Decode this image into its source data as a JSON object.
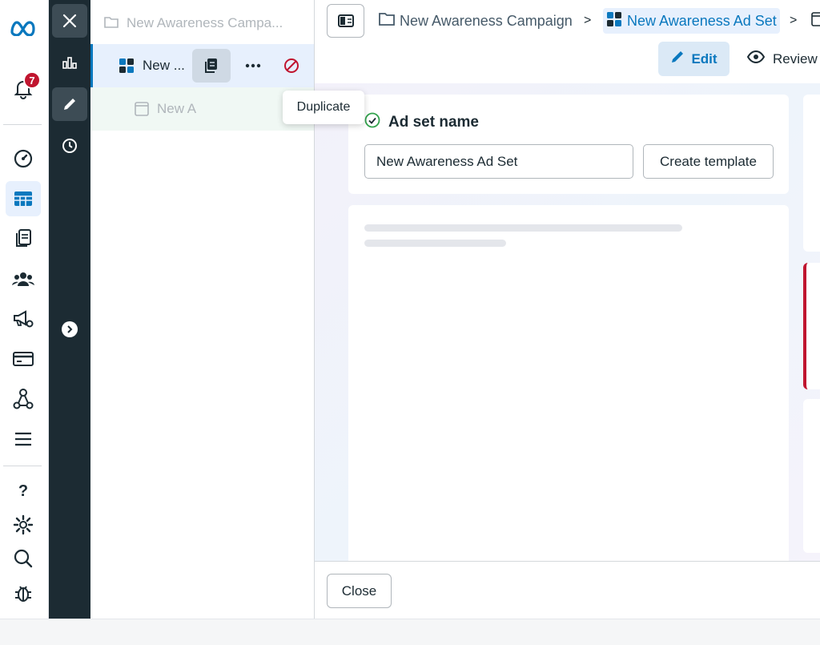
{
  "rail": {
    "notification_count": "7",
    "icons": [
      "meta-logo-icon",
      "bell-icon",
      "gauge-icon",
      "table-icon",
      "pages-icon",
      "people-icon",
      "megaphone-gear-icon",
      "card-icon",
      "network-icon",
      "menu-icon",
      "help-icon",
      "gear-icon",
      "search-icon",
      "bug-icon"
    ]
  },
  "strip": {
    "icons": [
      "close-icon",
      "bar-chart-icon",
      "pencil-icon",
      "clock-icon",
      "chevron-right-circle-icon"
    ]
  },
  "tree": {
    "campaign_label": "New Awareness Campa...",
    "adset_label": "New ...",
    "ad_label": "New A",
    "tooltip": "Duplicate"
  },
  "breadcrumb": {
    "campaign": "New Awareness Campaign",
    "adset": "New Awareness Ad Set",
    "separator": ">"
  },
  "actions": {
    "edit": "Edit",
    "review": "Review"
  },
  "adset_card": {
    "title": "Ad set name",
    "name_value": "New Awareness Ad Set",
    "create_template": "Create template"
  },
  "footer": {
    "close": "Close"
  },
  "colors": {
    "accent": "#0a78be",
    "dark_strip": "#1c2b33",
    "error": "#c0152f",
    "success": "#31a24c"
  }
}
